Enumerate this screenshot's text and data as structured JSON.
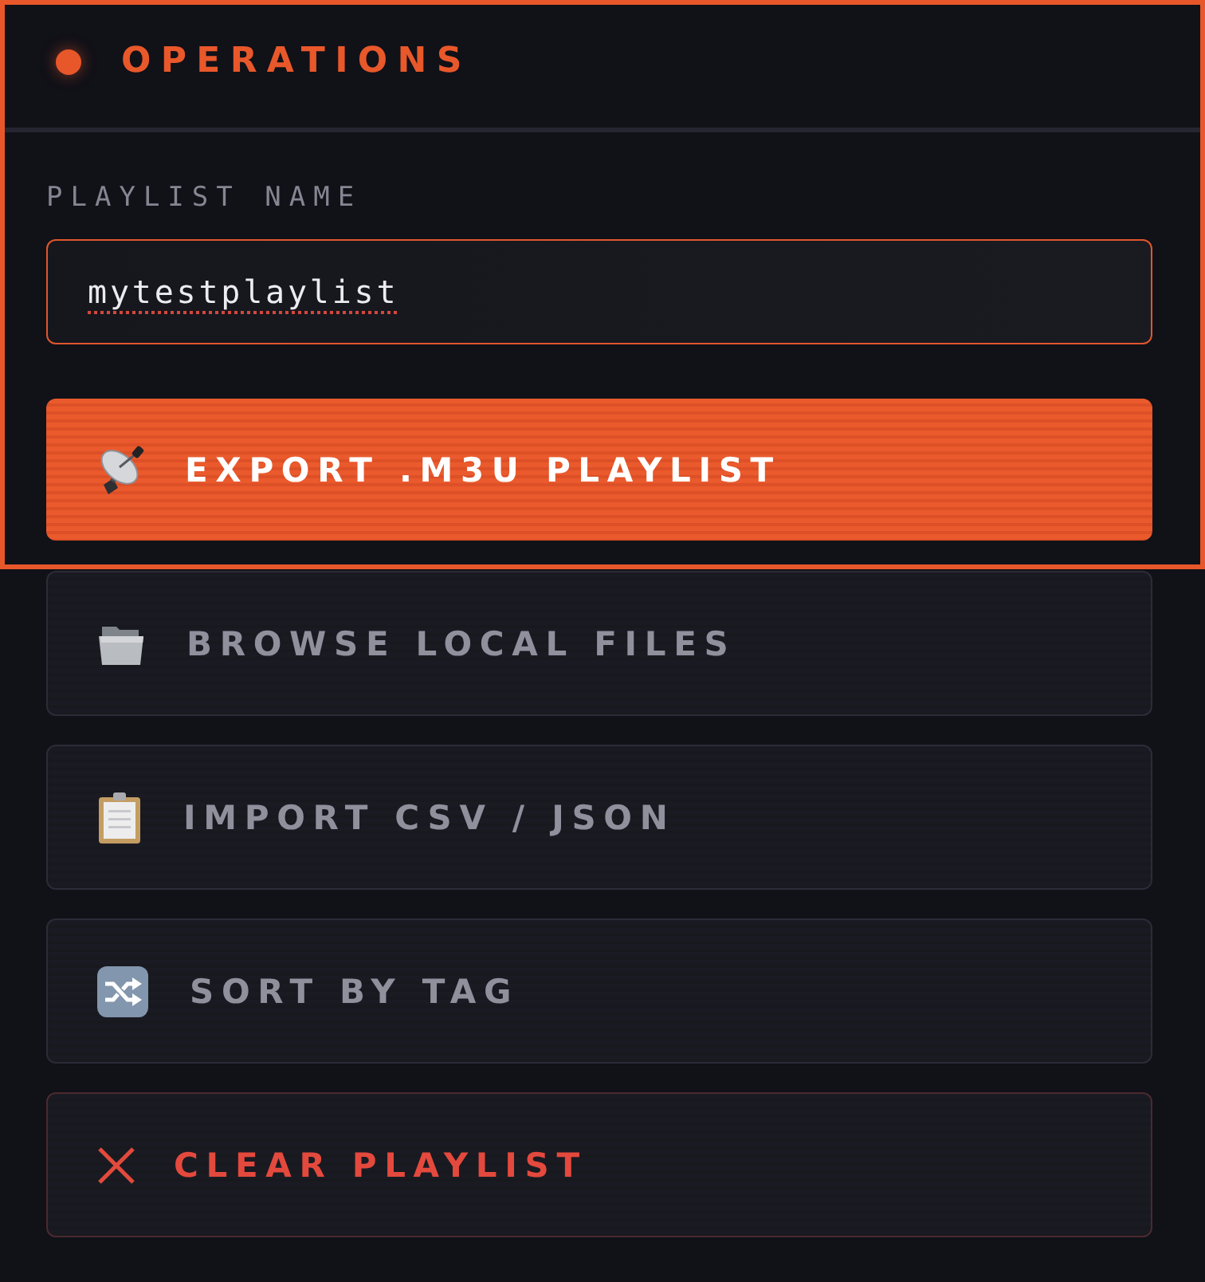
{
  "highlight_frame": true,
  "header": {
    "title": "OPERATIONS"
  },
  "playlist_name": {
    "label": "PLAYLIST NAME",
    "value": "mytestplaylist",
    "spelling_flagged": true
  },
  "actions": [
    {
      "label": "EXPORT .M3U PLAYLIST",
      "kind": "primary"
    },
    {
      "label": "BROWSE LOCAL FILES",
      "kind": "secondary"
    },
    {
      "label": "IMPORT CSV / JSON",
      "kind": "secondary"
    },
    {
      "label": "SORT BY TAG",
      "kind": "secondary"
    },
    {
      "label": "CLEAR PLAYLIST",
      "kind": "danger"
    }
  ]
}
